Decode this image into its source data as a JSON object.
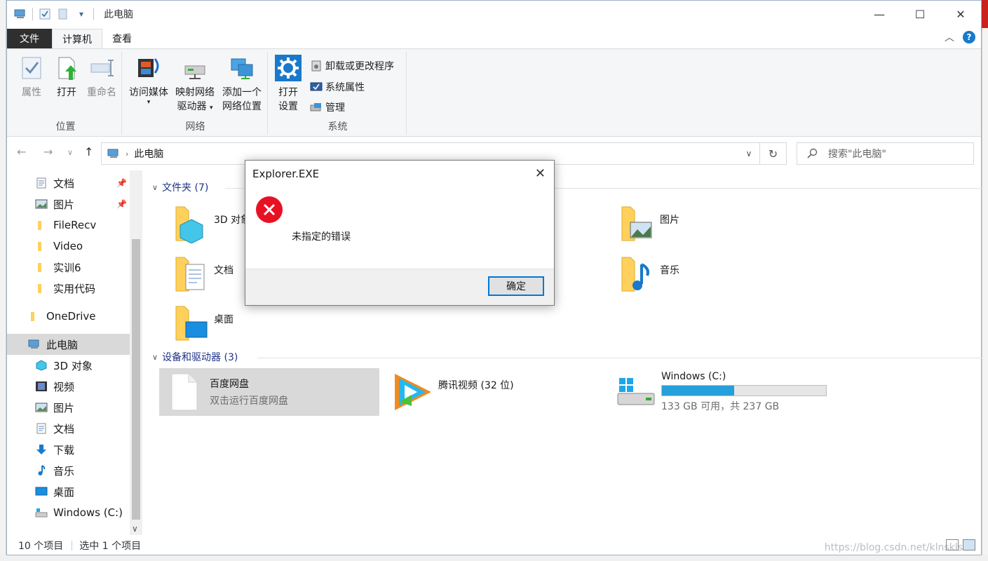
{
  "window": {
    "title": "此电脑",
    "controls": {
      "minimize": "—",
      "maximize": "☐",
      "close": "✕"
    }
  },
  "tabs": [
    {
      "label": "文件"
    },
    {
      "label": "计算机"
    },
    {
      "label": "查看"
    }
  ],
  "ribbon": {
    "groups": [
      {
        "label": "位置",
        "buttons": [
          "属性",
          "打开",
          "重命名"
        ]
      },
      {
        "label": "网络",
        "buttons": [
          "访问媒体",
          "映射网络\n驱动器",
          "添加一个\n网络位置"
        ]
      },
      {
        "label": "系统",
        "big": "打开\n设置",
        "small": [
          "卸载或更改程序",
          "系统属性",
          "管理"
        ]
      }
    ],
    "access_media": "访问媒体",
    "map_drive_1": "映射网络",
    "map_drive_2": "驱动器",
    "add_net_1": "添加一个",
    "add_net_2": "网络位置",
    "open_settings_1": "打开",
    "open_settings_2": "设置"
  },
  "address": {
    "path": "此电脑",
    "search_placeholder": "搜索\"此电脑\""
  },
  "sidebar": {
    "items": [
      {
        "label": "文档",
        "pinned": true
      },
      {
        "label": "图片",
        "pinned": true
      },
      {
        "label": "FileRecv"
      },
      {
        "label": "Video"
      },
      {
        "label": "实训6"
      },
      {
        "label": "实用代码"
      },
      {
        "label": "OneDrive"
      },
      {
        "label": "此电脑",
        "selected": true
      },
      {
        "label": "3D 对象"
      },
      {
        "label": "视频"
      },
      {
        "label": "图片"
      },
      {
        "label": "文档"
      },
      {
        "label": "下载"
      },
      {
        "label": "音乐"
      },
      {
        "label": "桌面"
      },
      {
        "label": "Windows (C:)"
      }
    ]
  },
  "content": {
    "folders_header": "文件夹 (7)",
    "folders": [
      {
        "label": "3D 对象"
      },
      {
        "label": "图片"
      },
      {
        "label": "文档"
      },
      {
        "label": "音乐"
      },
      {
        "label": "桌面"
      }
    ],
    "devices_header": "设备和驱动器 (3)",
    "devices": [
      {
        "label": "百度网盘",
        "sub": "双击运行百度网盘"
      },
      {
        "label": "腾讯视频 (32 位)"
      },
      {
        "label": "Windows (C:)",
        "sub": "133 GB 可用，共 237 GB",
        "used_fraction": 0.44
      }
    ]
  },
  "status": {
    "count": "10 个项目",
    "selected": "选中 1 个项目",
    "watermark": "https://blog.csdn.net/klnskls"
  },
  "dialog": {
    "title": "Explorer.EXE",
    "message": "未指定的错误",
    "ok": "确定"
  },
  "colors": {
    "accent": "#0078d7",
    "drive_bar": "#26a0da",
    "error_red": "#e81123",
    "header_blue": "#1e3287"
  }
}
